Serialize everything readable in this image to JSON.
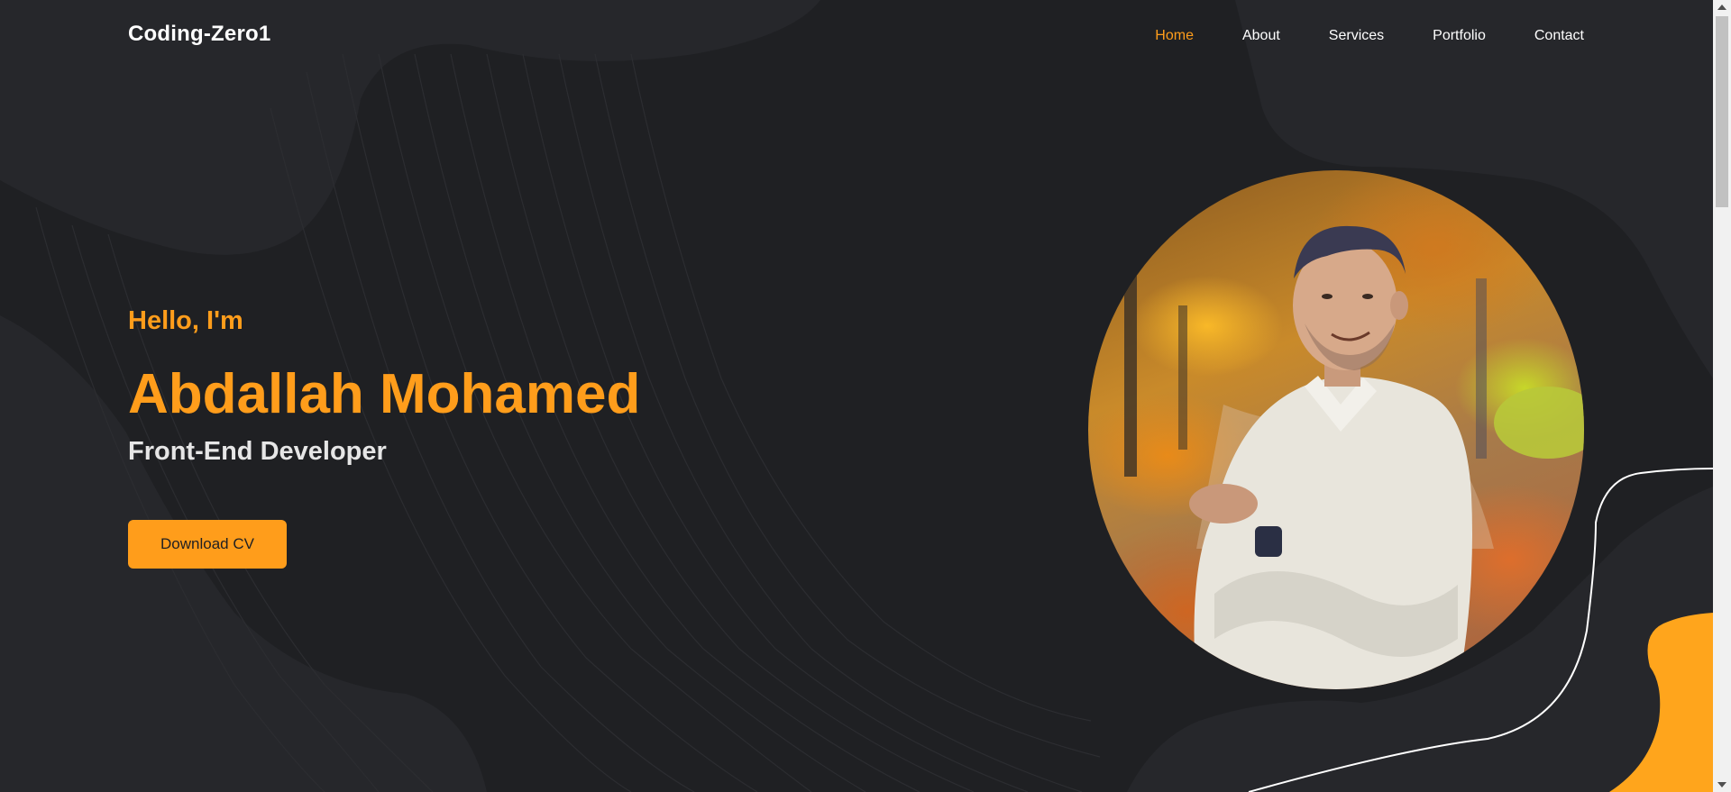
{
  "navbar": {
    "logo": "Coding-Zero1",
    "links": [
      {
        "label": "Home",
        "active": true
      },
      {
        "label": "About",
        "active": false
      },
      {
        "label": "Services",
        "active": false
      },
      {
        "label": "Portfolio",
        "active": false
      },
      {
        "label": "Contact",
        "active": false
      }
    ]
  },
  "hero": {
    "greeting": "Hello, I'm",
    "name": "Abdallah Mohamed",
    "role": "Front-End Developer",
    "cta_label": "Download CV",
    "portrait_icon": "profile-photo"
  },
  "colors": {
    "background": "#1f2023",
    "accent": "#ff9d1b",
    "text": "#ffffff"
  }
}
